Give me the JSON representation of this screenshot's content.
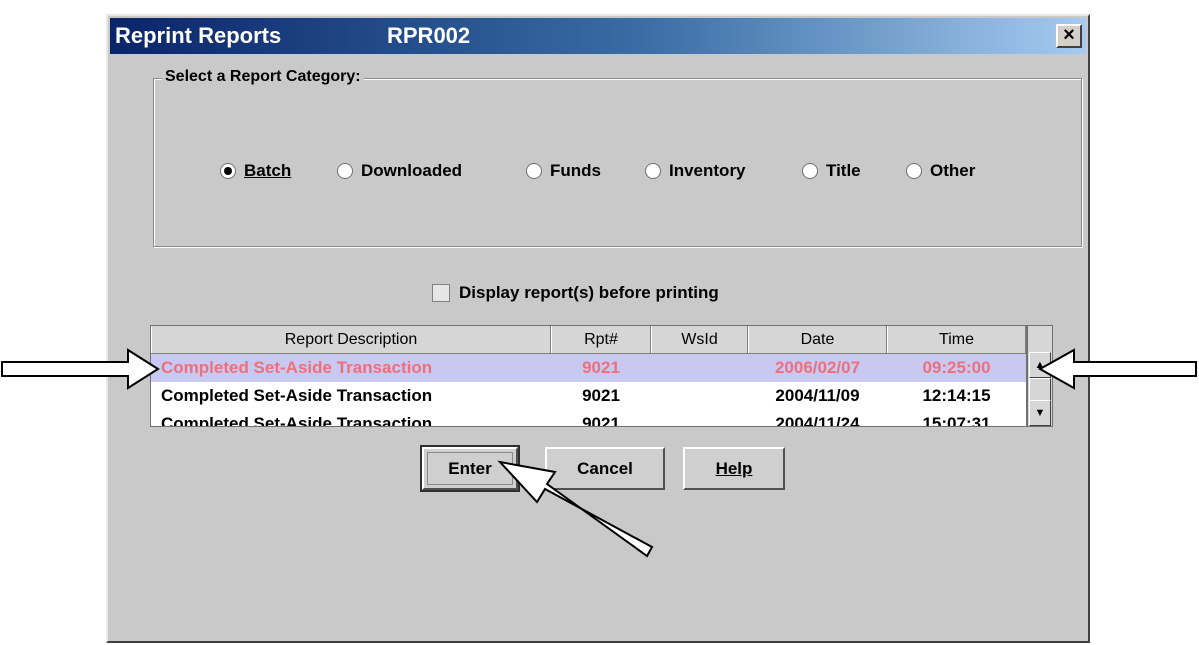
{
  "window": {
    "title": "Reprint Reports",
    "code": "RPR002",
    "close_label": "×"
  },
  "category": {
    "legend": "Select a Report Category:",
    "options": [
      {
        "label": "Batch",
        "selected": true
      },
      {
        "label": "Downloaded",
        "selected": false
      },
      {
        "label": "Funds",
        "selected": false
      },
      {
        "label": "Inventory",
        "selected": false
      },
      {
        "label": "Title",
        "selected": false
      },
      {
        "label": "Other",
        "selected": false
      }
    ]
  },
  "display_checkbox": {
    "label": "Display report(s) before printing",
    "checked": false
  },
  "table": {
    "headers": [
      "Report Description",
      "Rpt#",
      "WsId",
      "Date",
      "Time"
    ],
    "rows": [
      {
        "description": "Completed Set-Aside Transaction",
        "rpt": "9021",
        "wsid": "",
        "date": "2006/02/07",
        "time": "09:25:00",
        "selected": true
      },
      {
        "description": "Completed Set-Aside Transaction",
        "rpt": "9021",
        "wsid": "",
        "date": "2004/11/09",
        "time": "12:14:15",
        "selected": false
      },
      {
        "description": "Completed Set-Aside Transaction",
        "rpt": "9021",
        "wsid": "",
        "date": "2004/11/24",
        "time": "15:07:31",
        "selected": false
      }
    ]
  },
  "buttons": {
    "enter": "Enter",
    "cancel": "Cancel",
    "help": "Help"
  },
  "colors": {
    "selected_row_bg": "#c8c8f0",
    "selected_row_text": "#ef6f7b",
    "window_bg": "#c9c9c9",
    "titlebar_start": "#0a246a"
  },
  "icons": [
    "close-icon",
    "radio-icon",
    "checkbox-icon",
    "scroll-up-icon",
    "scroll-down-icon",
    "arrow-annotation-icon"
  ]
}
